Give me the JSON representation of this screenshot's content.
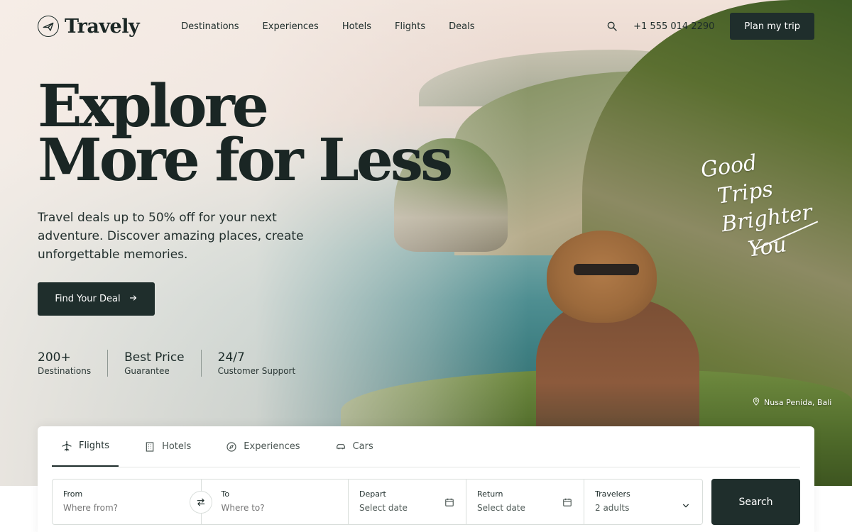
{
  "brand": {
    "name": "Travely",
    "logo_icon": "plane-in-circle-icon"
  },
  "nav": {
    "links": [
      "Destinations",
      "Experiences",
      "Hotels",
      "Flights",
      "Deals"
    ],
    "phone": "+1 555 014 2290",
    "cta_label": "Plan my trip"
  },
  "hero": {
    "headline_line1": "Explore",
    "headline_line2": "More for Less",
    "subtext": "Travel deals up to 50% off for your next adventure. Discover amazing places, create unforgettable memories.",
    "cta_label": "Find Your Deal",
    "stats": [
      {
        "value": "200+",
        "label": "Destinations"
      },
      {
        "value": "Best Price",
        "label": "Guarantee"
      },
      {
        "value": "24/7",
        "label": "Customer Support"
      }
    ],
    "script_note": [
      "Good",
      "Trips",
      "Brighter",
      "You"
    ],
    "location": "Nusa Penida, Bali"
  },
  "booking": {
    "tabs": [
      {
        "label": "Flights",
        "icon": "plane-icon",
        "active": true
      },
      {
        "label": "Hotels",
        "icon": "building-icon",
        "active": false
      },
      {
        "label": "Experiences",
        "icon": "compass-icon",
        "active": false
      },
      {
        "label": "Cars",
        "icon": "car-icon",
        "active": false
      }
    ],
    "from": {
      "label": "From",
      "placeholder": "Where from?"
    },
    "to": {
      "label": "To",
      "placeholder": "Where to?"
    },
    "depart": {
      "label": "Depart",
      "value": "Select date"
    },
    "return": {
      "label": "Return",
      "value": "Select date"
    },
    "travelers": {
      "label": "Travelers",
      "value": "2 adults"
    },
    "search_label": "Search"
  },
  "colors": {
    "primary": "#1f2e2c",
    "text": "#1c2b29",
    "panel": "#ffffff"
  }
}
